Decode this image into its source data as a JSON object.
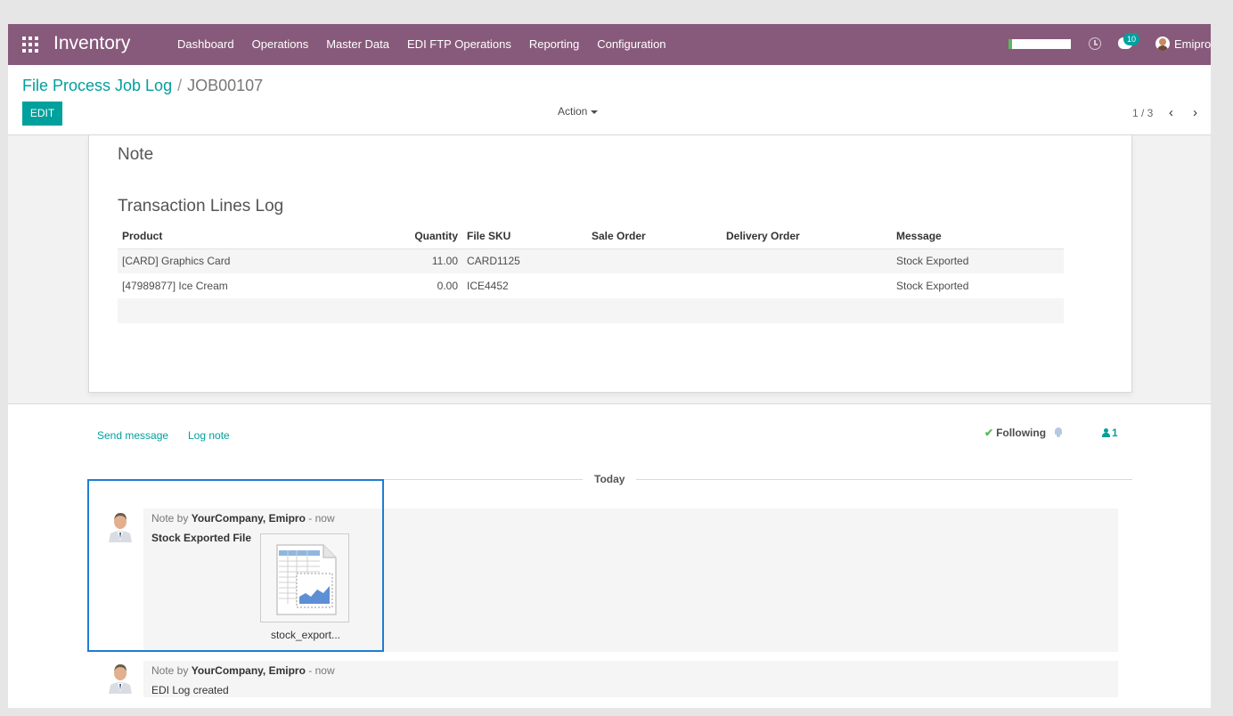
{
  "navbar": {
    "app_name": "Inventory",
    "menu": [
      "Dashboard",
      "Operations",
      "Master Data",
      "EDI FTP Operations",
      "Reporting",
      "Configuration"
    ],
    "chat_count": "10",
    "user_name": "Emipro",
    "accent_color": "#875a7b",
    "progress_fraction": 0.06
  },
  "control_panel": {
    "breadcrumb_parent": "File Process Job Log",
    "breadcrumb_separator": "/",
    "breadcrumb_current": "JOB00107",
    "edit_label": "EDIT",
    "action_label": "Action",
    "pager": "1 / 3",
    "prev_icon": "‹",
    "next_icon": "›"
  },
  "form": {
    "note_title": "Note",
    "transaction_title": "Transaction Lines Log",
    "columns": [
      "Product",
      "Quantity",
      "File SKU",
      "Sale Order",
      "Delivery Order",
      "Message"
    ],
    "rows": [
      [
        "[CARD] Graphics Card",
        "11.00",
        "CARD1125",
        "",
        "",
        "Stock Exported"
      ],
      [
        "[47989877] Ice Cream",
        "0.00",
        "ICE4452",
        "",
        "",
        "Stock Exported"
      ]
    ]
  },
  "chatter": {
    "send_message": "Send message",
    "log_note": "Log note",
    "following": "Following",
    "check_icon": "✔",
    "followers_count": "1",
    "date_separator": "Today",
    "messages": [
      {
        "prefix": "Note by",
        "author": "YourCompany, Emipro",
        "time": "- now",
        "body": "Stock Exported File",
        "attachment_name": "stock_export..."
      },
      {
        "prefix": "Note by",
        "author": "YourCompany, Emipro",
        "time": "- now",
        "body": "EDI Log created"
      }
    ]
  }
}
